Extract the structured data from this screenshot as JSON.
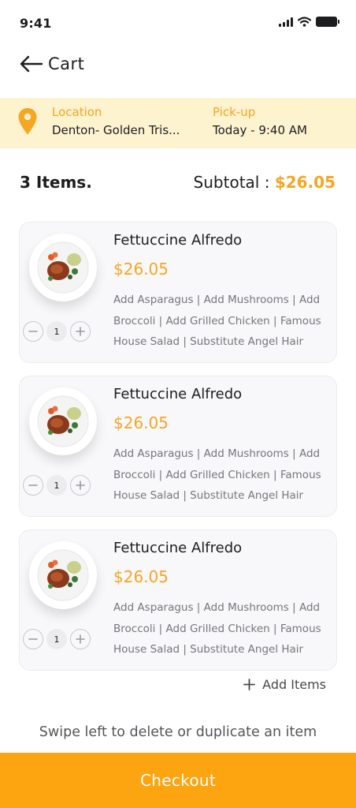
{
  "status_bar": {
    "time": "9:41"
  },
  "header": {
    "title": "Cart"
  },
  "order_info": {
    "location_label": "Location",
    "location_value": "Denton- Golden Tris...",
    "pickup_label": "Pick-up",
    "pickup_value": "Today - 9:40 AM"
  },
  "summary": {
    "items_count": "3 Items.",
    "subtotal_label": "Subtotal : ",
    "subtotal_amount": "$26.05"
  },
  "cart_items": [
    {
      "name": "Fettuccine Alfredo",
      "price": "$26.05",
      "description": "Add Asparagus | Add Mushrooms | Add Broccoli | Add Grilled Chicken | Famous House Salad | Substitute Angel Hair",
      "quantity": "1"
    },
    {
      "name": "Fettuccine Alfredo",
      "price": "$26.05",
      "description": "Add Asparagus | Add Mushrooms | Add Broccoli | Add Grilled Chicken | Famous House Salad | Substitute Angel Hair",
      "quantity": "1"
    },
    {
      "name": "Fettuccine Alfredo",
      "price": "$26.05",
      "description": "Add Asparagus | Add Mushrooms | Add Broccoli | Add Grilled Chicken | Famous House Salad | Substitute Angel Hair",
      "quantity": "1"
    }
  ],
  "add_items_label": "Add Items",
  "swipe_hint": "Swipe left to delete or duplicate an item",
  "checkout_label": "Checkout",
  "colors": {
    "accent": "#f5a623",
    "checkout": "#fca510",
    "location_bg": "#fdf3cf"
  },
  "icons": [
    "back-arrow-icon",
    "location-pin-icon",
    "minus-icon",
    "plus-icon",
    "signal-icon",
    "wifi-icon",
    "battery-icon"
  ]
}
